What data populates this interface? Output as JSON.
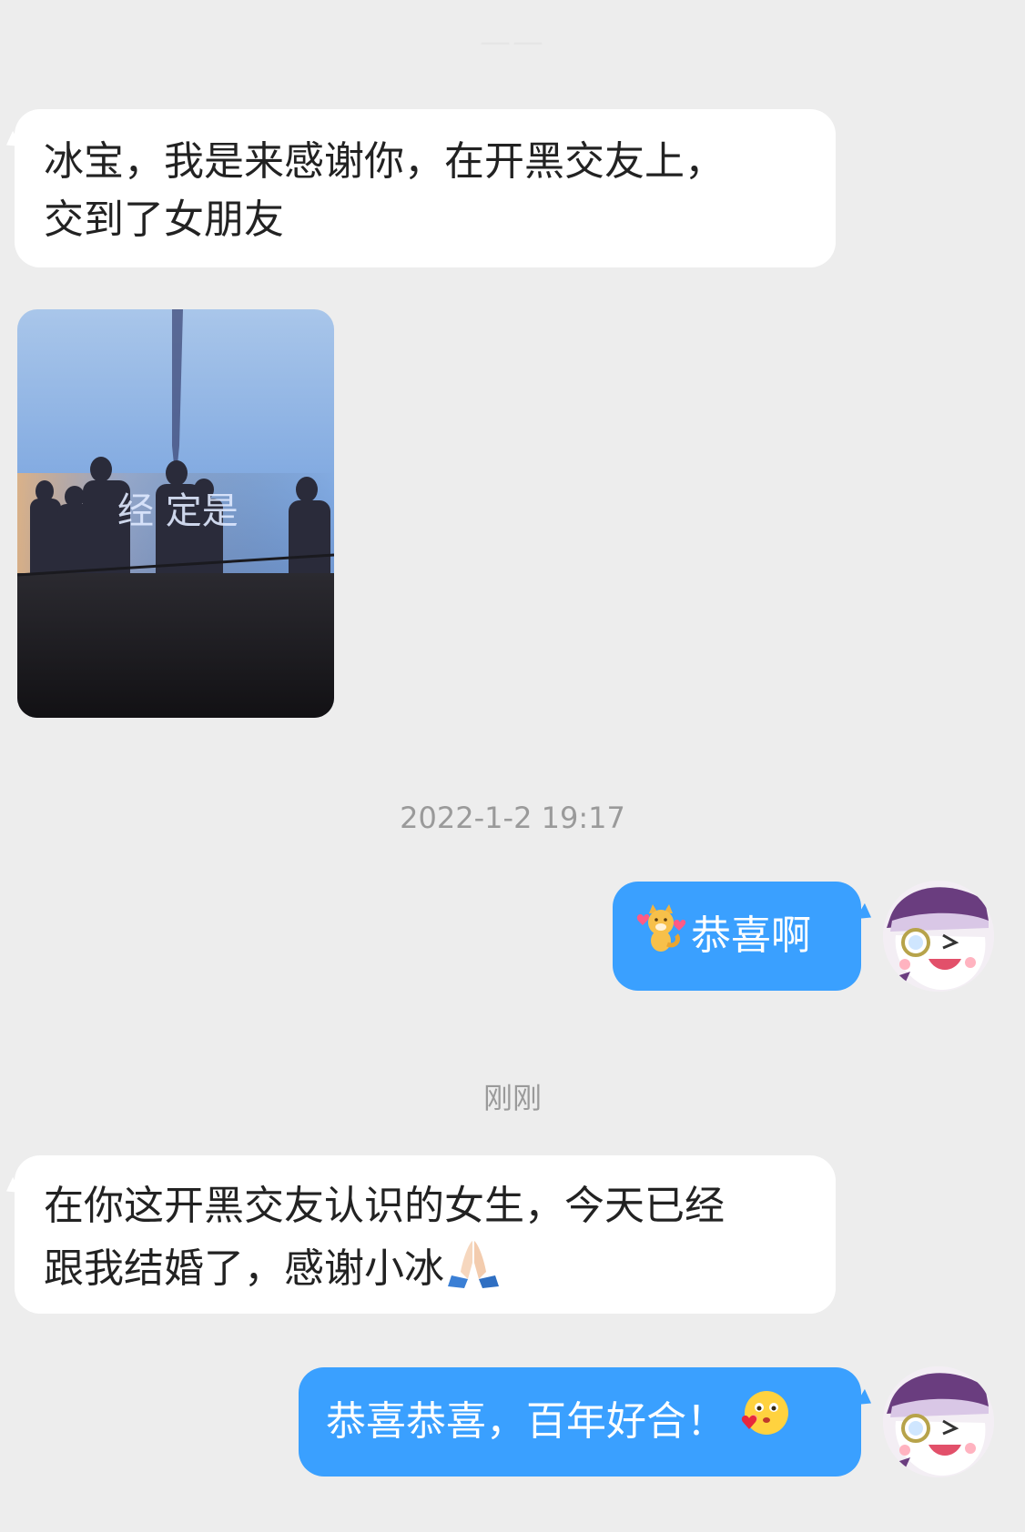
{
  "header": {
    "title": "——"
  },
  "messages": [
    {
      "side": "left",
      "type": "text",
      "line1": "冰宝，我是来感谢你，在开黑交友上，",
      "line2": "交到了女朋友"
    },
    {
      "side": "left",
      "type": "image",
      "image_overlay_text": "经 定是"
    },
    {
      "timestamp": "2022-1-2 19:17"
    },
    {
      "side": "right",
      "type": "text",
      "emoji": "fox-hearts-sticker-icon",
      "text": "恭喜啊"
    },
    {
      "timestamp": "刚刚"
    },
    {
      "side": "left",
      "type": "text",
      "line1": "在你这开黑交友认识的女生，今天已经",
      "line2": "跟我结婚了，感谢小冰",
      "emoji": "folded-hands-icon"
    },
    {
      "side": "right",
      "type": "text",
      "text": "恭喜恭喜，百年好合！",
      "emoji": "blushing-heart-face-icon"
    }
  ],
  "colors": {
    "background": "#ededed",
    "bubble_left": "#ffffff",
    "bubble_right": "#3aa0ff",
    "timestamp": "#9a9a9a"
  }
}
